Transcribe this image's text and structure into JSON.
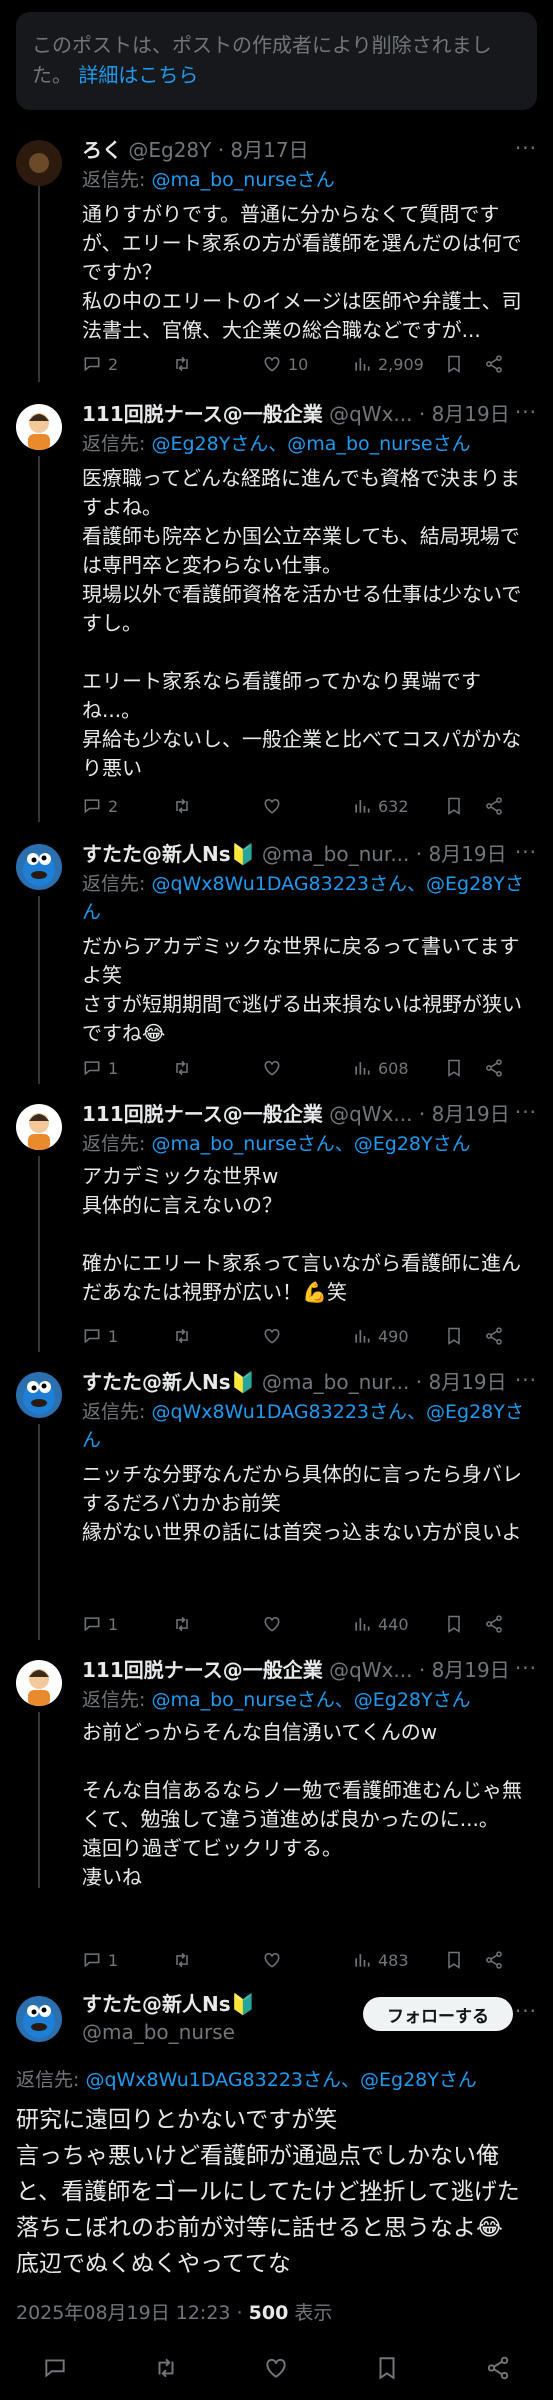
{
  "deleted_notice": {
    "text": "このポストは、ポストの作成者により削除されました。",
    "link": "詳細はこちら"
  },
  "tweets": [
    {
      "name": "ろく",
      "handle": "@Eg28Y",
      "date": "· 8月17日",
      "reply_prefix": "返信先: ",
      "reply_to": "@ma_bo_nurseさん",
      "body": "通りすがりです。普通に分からなくて質問ですが、エリート家系の方が看護師を選んだのは何でですか？\n私の中のエリートのイメージは医師や弁護士、司法書士、官僚、大企業の総合職などですが...",
      "replies": "2",
      "retweets": "",
      "likes": "10",
      "views": "2,909"
    },
    {
      "name": "111回脱ナース@一般企業",
      "handle": "@qWx...",
      "date": "· 8月19日",
      "reply_prefix": "返信先: ",
      "reply_to": "@Eg28Yさん、@ma_bo_nurseさん",
      "body": "医療職ってどんな経路に進んでも資格で決まりますよね。\n看護師も院卒とか国公立卒業しても、結局現場では専門卒と変わらない仕事。\n現場以外で看護師資格を活かせる仕事は少ないですし。\n\nエリート家系なら看護師ってかなり異端ですね...。\n昇給も少ないし、一般企業と比べてコスパがかなり悪い",
      "replies": "2",
      "retweets": "",
      "likes": "",
      "views": "632"
    },
    {
      "name": "すたた@新人Ns🔰",
      "handle": "@ma_bo_nur...",
      "date": "· 8月19日",
      "reply_prefix": "返信先: ",
      "reply_to": "@qWx8Wu1DAG83223さん、@Eg28Yさん",
      "body": "だからアカデミックな世界に戻るって書いてますよ笑\nさすが短期期間で逃げる出来損ないは視野が狭いですね😂",
      "replies": "1",
      "retweets": "",
      "likes": "",
      "views": "608"
    },
    {
      "name": "111回脱ナース@一般企業",
      "handle": "@qWx...",
      "date": "· 8月19日",
      "reply_prefix": "返信先: ",
      "reply_to": "@ma_bo_nurseさん、@Eg28Yさん",
      "body": "アカデミックな世界w\n具体的に言えないの？\n\n確かにエリート家系って言いながら看護師に進んだあなたは視野が広い！💪笑",
      "replies": "1",
      "retweets": "",
      "likes": "",
      "views": "490"
    },
    {
      "name": "すたた@新人Ns🔰",
      "handle": "@ma_bo_nur...",
      "date": "· 8月19日",
      "reply_prefix": "返信先: ",
      "reply_to": "@qWx8Wu1DAG83223さん、@Eg28Yさん",
      "body": "ニッチな分野なんだから具体的に言ったら身バレするだろバカかお前笑\n縁がない世界の話には首突っ込まない方が良いよ",
      "replies": "1",
      "retweets": "",
      "likes": "",
      "views": "440"
    },
    {
      "name": "111回脱ナース@一般企業",
      "handle": "@qWx...",
      "date": "· 8月19日",
      "reply_prefix": "返信先: ",
      "reply_to": "@ma_bo_nurseさん、@Eg28Yさん",
      "body": "お前どっからそんな自信湧いてくんのw\n\nそんな自信あるならノー勉で看護師進むんじゃ無くて、勉強して違う道進めば良かったのに...。\n遠回り過ぎてビックリする。\n凄いね",
      "replies": "1",
      "retweets": "",
      "likes": "",
      "views": "483"
    }
  ],
  "main_post": {
    "name": "すたた@新人Ns🔰",
    "handle": "@ma_bo_nurse",
    "follow_label": "フォローする",
    "reply_prefix": "返信先: ",
    "reply_to": "@qWx8Wu1DAG83223さん、@Eg28Yさん",
    "body": "研究に遠回りとかないですが笑\n言っちゃ悪いけど看護師が通過点でしかない俺と、看護師をゴールにしてたけど挫折して逃げた落ちこぼれのお前が対等に話せると思うなよ😂\n底辺でぬくぬくやっててな",
    "timestamp": "2025年08月19日 12:23 · ",
    "views": "500",
    "views_label": " 表示"
  },
  "icons": {
    "reply": "reply-icon",
    "retweet": "retweet-icon",
    "like": "heart-icon",
    "views": "views-icon",
    "bookmark": "bookmark-icon",
    "share": "share-icon"
  },
  "colors": {
    "background": "#000000",
    "accent": "#1d9bf0",
    "muted": "#71767b",
    "text": "#e7e9ea"
  }
}
